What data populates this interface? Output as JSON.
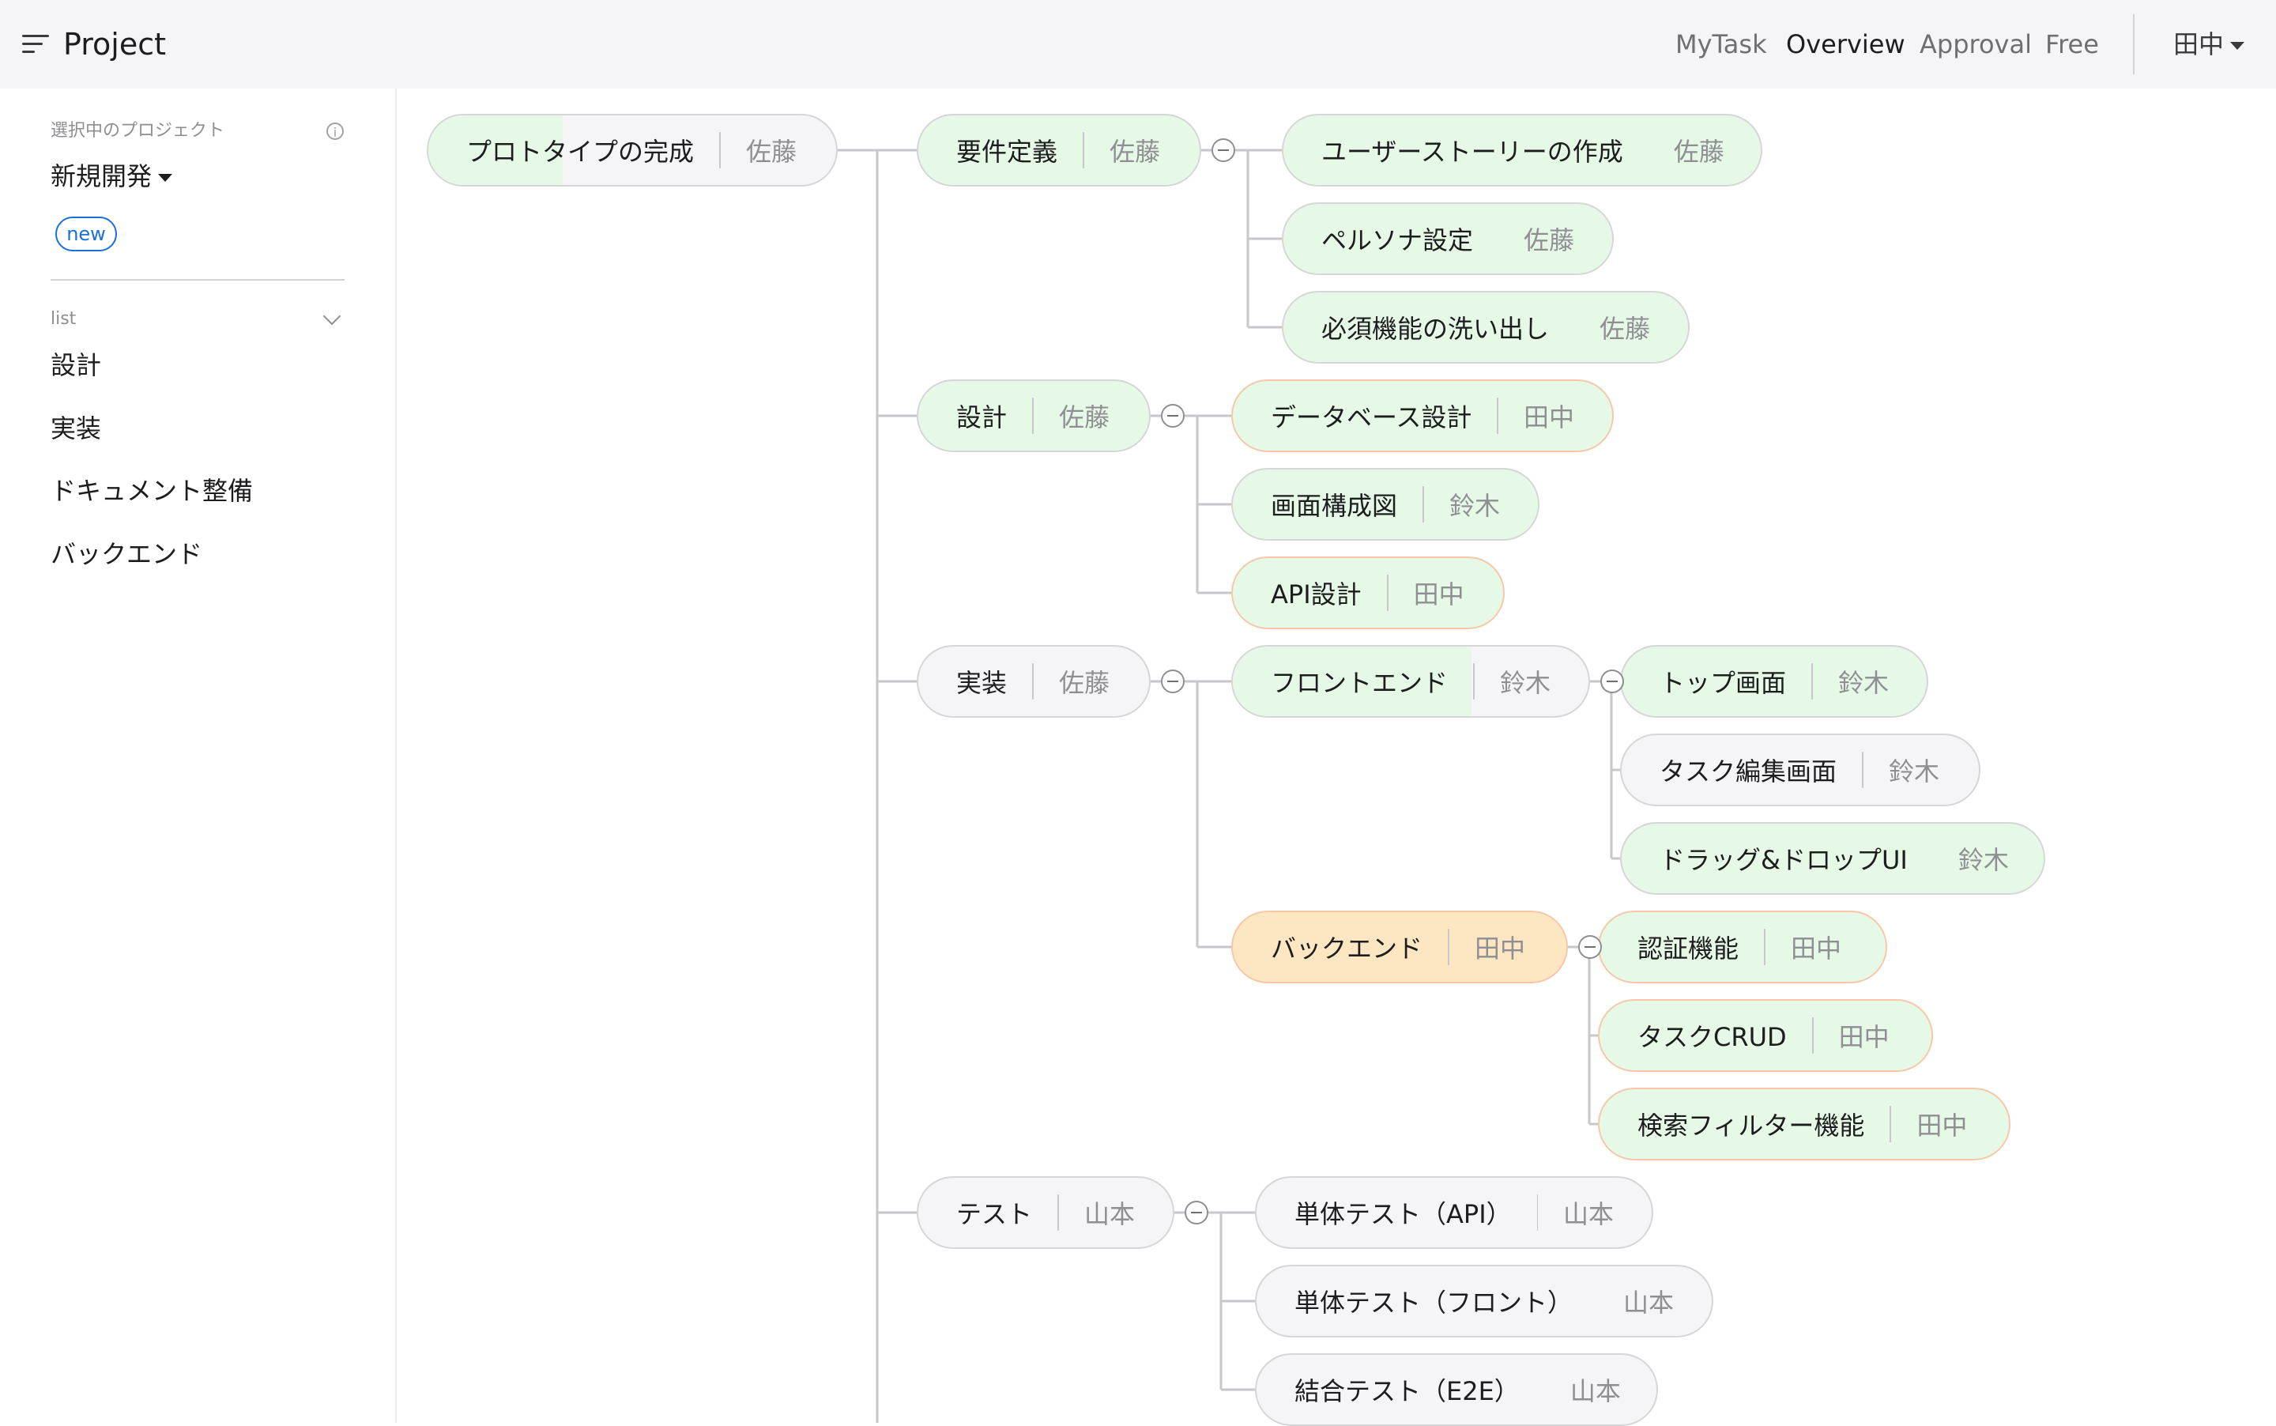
{
  "header": {
    "title": "Project",
    "nav": [
      {
        "label": "MyTask",
        "active": false
      },
      {
        "label": "Overview",
        "active": true
      },
      {
        "label": "Approval",
        "active": false
      },
      {
        "label": "Free",
        "active": false
      }
    ],
    "user": "田中"
  },
  "sidebar": {
    "selected_label": "選択中のプロジェクト",
    "project_name": "新規開発",
    "badge": "new",
    "list_label": "list",
    "items": [
      "設計",
      "実装",
      "ドキュメント整備",
      "バックエンド"
    ]
  },
  "tree": {
    "root": {
      "label": "プロトタイプの完成",
      "owner": "佐藤",
      "progress": 0.33
    },
    "nodes": [
      {
        "label": "要件定義",
        "owner": "佐藤",
        "status": "done"
      },
      {
        "label": "ユーザーストーリーの作成",
        "owner": "佐藤",
        "status": "done"
      },
      {
        "label": "ペルソナ設定",
        "owner": "佐藤",
        "status": "done"
      },
      {
        "label": "必須機能の洗い出し",
        "owner": "佐藤",
        "status": "done"
      },
      {
        "label": "設計",
        "owner": "佐藤",
        "status": "done"
      },
      {
        "label": "データベース設計",
        "owner": "田中",
        "status": "done-mine"
      },
      {
        "label": "画面構成図",
        "owner": "鈴木",
        "status": "done"
      },
      {
        "label": "API設計",
        "owner": "田中",
        "status": "done-mine"
      },
      {
        "label": "実装",
        "owner": "佐藤",
        "status": "todo"
      },
      {
        "label": "フロントエンド",
        "owner": "鈴木",
        "status": "partial",
        "progress": 0.67
      },
      {
        "label": "トップ画面",
        "owner": "鈴木",
        "status": "done"
      },
      {
        "label": "タスク編集画面",
        "owner": "鈴木",
        "status": "todo"
      },
      {
        "label": "ドラッグ&ドロップUI",
        "owner": "鈴木",
        "status": "done"
      },
      {
        "label": "バックエンド",
        "owner": "田中",
        "status": "selected"
      },
      {
        "label": "認証機能",
        "owner": "田中",
        "status": "done-mine"
      },
      {
        "label": "タスクCRUD",
        "owner": "田中",
        "status": "done-mine"
      },
      {
        "label": "検索フィルター機能",
        "owner": "田中",
        "status": "done-mine"
      },
      {
        "label": "テスト",
        "owner": "山本",
        "status": "todo"
      },
      {
        "label": "単体テスト（API）",
        "owner": "山本",
        "status": "todo"
      },
      {
        "label": "単体テスト（フロント）",
        "owner": "山本",
        "status": "todo"
      },
      {
        "label": "結合テスト（E2E）",
        "owner": "山本",
        "status": "todo"
      }
    ]
  },
  "colors": {
    "done": "#e6f9e6",
    "todo": "#f5f5f7",
    "selected": "#fde6c2",
    "mine_border": "#f6c8a8",
    "accent": "#1a6fd8"
  }
}
